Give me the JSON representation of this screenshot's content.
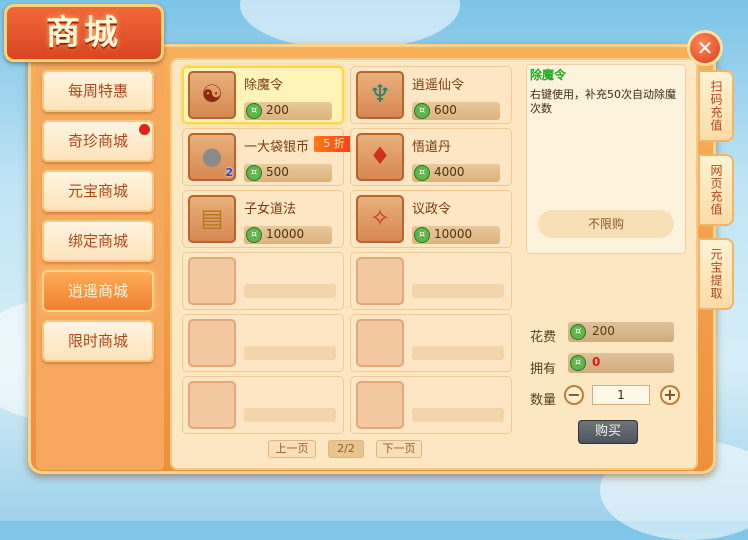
{
  "title": "商城",
  "sidebar": {
    "items": [
      {
        "label": "每周特惠"
      },
      {
        "label": "奇珍商城"
      },
      {
        "label": "元宝商城"
      },
      {
        "label": "绑定商城"
      },
      {
        "label": "逍遥商城"
      },
      {
        "label": "限时商城"
      }
    ]
  },
  "items": [
    {
      "name": "除魔令",
      "price": "200",
      "icon": "seal-token-icon"
    },
    {
      "name": "逍遥仙令",
      "price": "600",
      "icon": "jade-pendant-icon"
    },
    {
      "name": "一大袋银币",
      "price": "500",
      "icon": "silver-coin-bag-icon",
      "qty": "2",
      "discount": "5 折"
    },
    {
      "name": "悟道丹",
      "price": "4000",
      "icon": "elixir-chest-icon"
    },
    {
      "name": "子女道法",
      "price": "10000",
      "icon": "scroll-icon"
    },
    {
      "name": "议政令",
      "price": "10000",
      "icon": "order-token-icon"
    }
  ],
  "pagination": {
    "prev": "上一页",
    "page": "2/2",
    "next": "下一页"
  },
  "detail": {
    "title": "除魔令",
    "description": "右键使用，补充50次自动除魔次数",
    "limit": "不限购"
  },
  "purchase": {
    "cost_label": "花费",
    "cost_value": "200",
    "owned_label": "拥有",
    "owned_value": "0",
    "quantity_label": "数量",
    "quantity_value": "1",
    "buy_label": "购买"
  },
  "side_tabs": [
    {
      "label": "扫码充值"
    },
    {
      "label": "网页充值"
    },
    {
      "label": "元宝提取"
    }
  ],
  "colors": {
    "accent": "#f07d2a",
    "highlight": "#ffd64a",
    "discount": "#ff3a14",
    "detail_title": "#1dab22"
  }
}
